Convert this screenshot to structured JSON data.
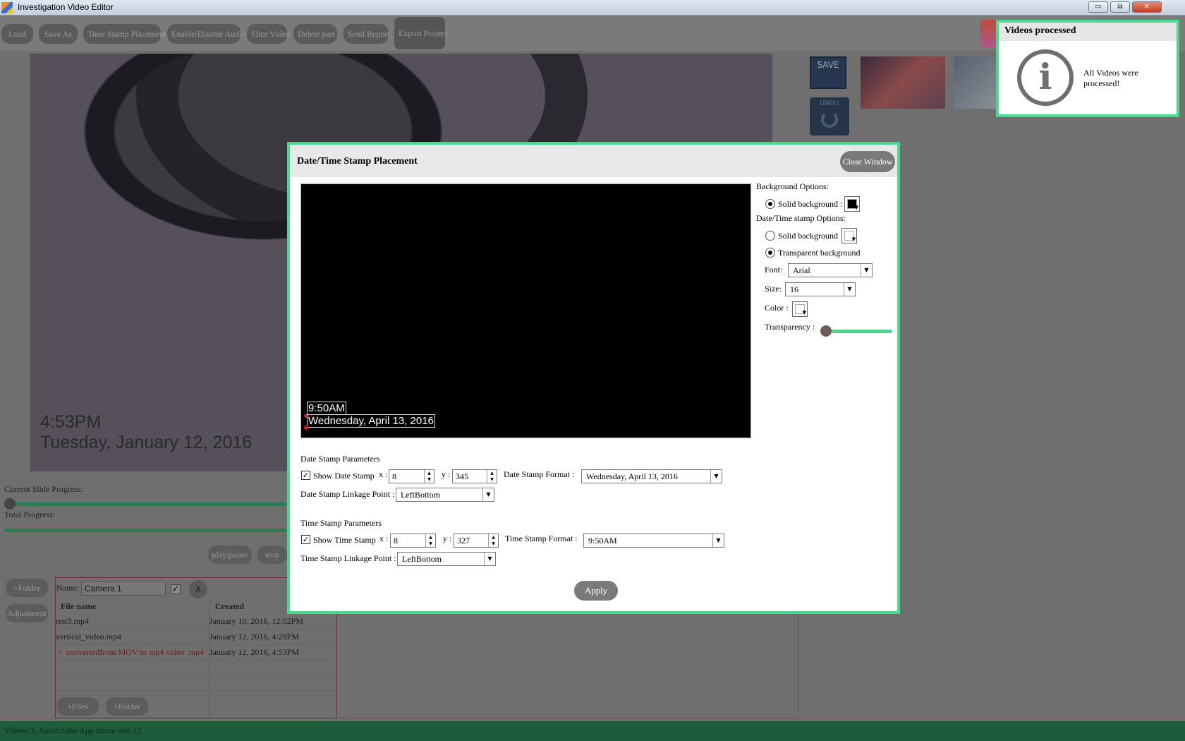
{
  "window": {
    "title": "Investigation Video Editor",
    "minimize": "▭",
    "restore": "⧉",
    "close": "✕"
  },
  "toolbar": {
    "items": [
      "Load",
      "Save As",
      "Time Stamp Placement",
      "Enable/Disable Audio",
      "Slice Video",
      "Delete part",
      "Send Report",
      "Export Project"
    ]
  },
  "video": {
    "time": "4:53PM",
    "date": "Tuesday, January 12, 2016"
  },
  "side": {
    "save_label": "SAVE",
    "undo_label": "UNDO"
  },
  "progress": {
    "current_label": "Current Slide Progress:",
    "total_label": "Total Progress:"
  },
  "player": {
    "play_pause": "play/pause",
    "stop": "stop"
  },
  "panel": {
    "add_folder": "+Folder",
    "adjustment": "Adjustment",
    "name_label": "Name:",
    "name_value": "Camera 1",
    "remove": "X",
    "col_file": "File name",
    "col_created": "Created",
    "files": [
      {
        "name": "test3.mp4",
        "created": "January 10, 2016, 12:52PM",
        "marker": ""
      },
      {
        "name": "vertical_video.mp4",
        "created": "January 12, 2016, 4:29PM",
        "marker": ""
      },
      {
        "name": "convertedfrom MOV to mp4 video .mp4",
        "created": "January 12, 2016, 4:53PM",
        "marker": ">"
      }
    ],
    "add_files": "+Files",
    "add_folder2": "+Folder"
  },
  "status": {
    "text": "Videos:3, Audio:false App frame rate:12"
  },
  "toast": {
    "title": "Videos processed",
    "icon": "i",
    "message": "All Videos were processed!"
  },
  "modal": {
    "title": "Date/Time Stamp Placement",
    "close": "Close Window",
    "preview": {
      "time": "9:50AM",
      "date": "Wednesday, April 13, 2016"
    },
    "bg_options": "Background Options:",
    "solid_bg": "Solid background :",
    "dt_options": "Date/Time stamp Options:",
    "dt_solid": "Solid background",
    "dt_transparent": "Transparent background",
    "font_label": "Font:",
    "font_value": "Arial",
    "size_label": "Size:",
    "size_value": "16",
    "color_label": "Color :",
    "transparency_label": "Transparency :",
    "transparency_value": 0,
    "date_params": "Date Stamp Parameters",
    "show_date": "Show Date Stamp",
    "date_x_label": "x :",
    "date_x": "8",
    "date_y_label": "y :",
    "date_y": "345",
    "date_format_label": "Date Stamp Format :",
    "date_format": "Wednesday, April 13, 2016",
    "date_link_label": "Date Stamp Linkage Point :",
    "date_link": "LeftBottom",
    "time_params": "Time Stamp Parameters",
    "show_time": "Show Time Stamp",
    "time_x_label": "x :",
    "time_x": "8",
    "time_y_label": "y :",
    "time_y": "327",
    "time_format_label": "Time Stamp Format :",
    "time_format": "9:50AM",
    "time_link_label": "Time Stamp Linkage Point :",
    "time_link": "LeftBottom",
    "apply": "Apply"
  },
  "colors": {
    "accent": "#47d98e",
    "status_bar": "#1d5b3a",
    "overlay": "#6f6f6f"
  }
}
